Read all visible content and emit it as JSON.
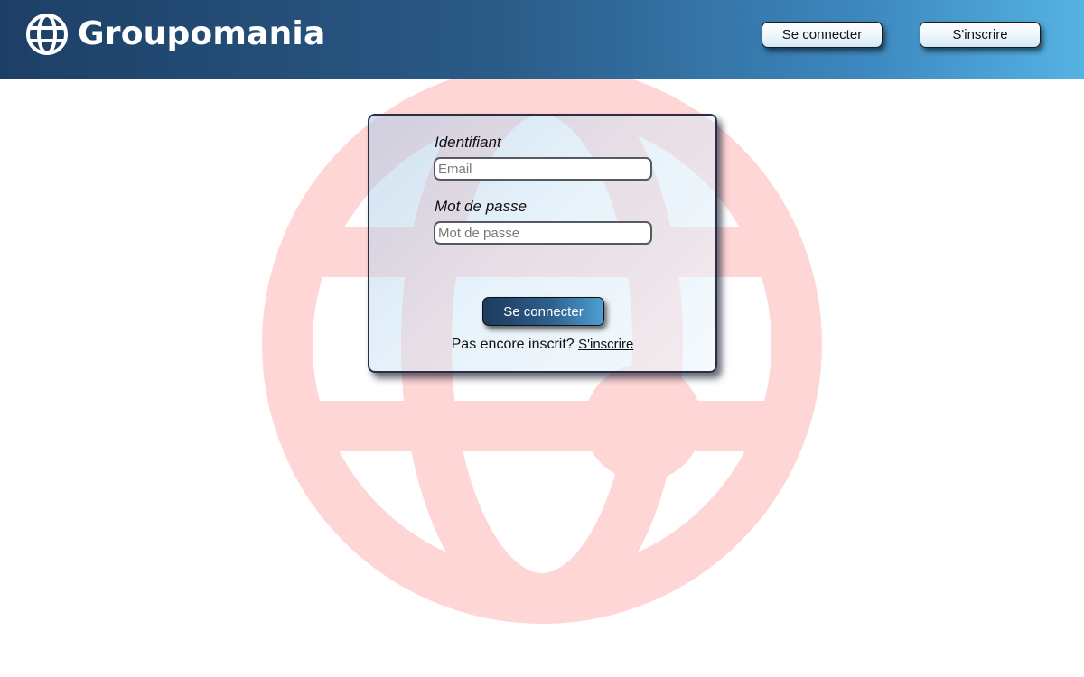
{
  "header": {
    "brand": "Groupomania",
    "logo_icon": "globe-icon",
    "nav": {
      "login_label": "Se connecter",
      "signup_label": "S'inscrire"
    }
  },
  "background": {
    "watermark_icon": "globe-icon",
    "watermark_color": "#ffd6d6"
  },
  "login_form": {
    "identifier_label": "Identifiant",
    "email_placeholder": "Email",
    "email_value": "",
    "password_label": "Mot de passe",
    "password_placeholder": "Mot de passe",
    "password_value": "",
    "submit_label": "Se connecter",
    "signup_prompt": "Pas encore inscrit?",
    "signup_link": "S'inscrire"
  },
  "colors": {
    "header_start": "#1d3f66",
    "header_end": "#55b3e3",
    "button_dark": "#1d3a5e",
    "button_light": "#4e9fd3"
  }
}
